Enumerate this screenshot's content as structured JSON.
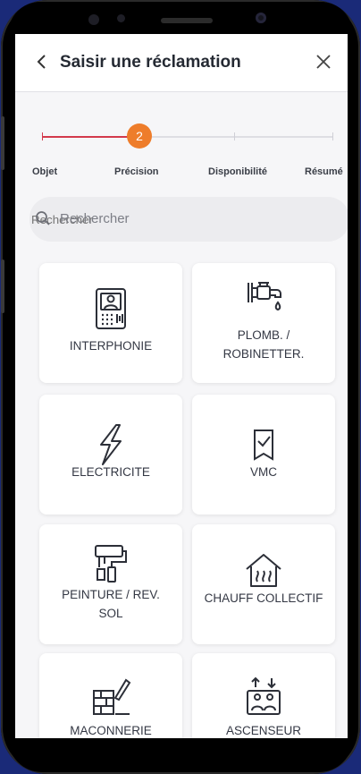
{
  "header": {
    "title": "Saisir une réclamation"
  },
  "stepper": {
    "current": "2",
    "steps": [
      "Objet",
      "Précision",
      "Disponibilité",
      "Résumé"
    ],
    "accent_color": "#ee7d2b",
    "done_color": "#d33a4c"
  },
  "search": {
    "placeholder": "Rechercher"
  },
  "categories": [
    {
      "label_line1": "INTERPHONIE",
      "label_line2": "",
      "icon": "intercom-icon"
    },
    {
      "label_line1": "PLOMB. /",
      "label_line2": "ROBINETTER.",
      "icon": "faucet-icon"
    },
    {
      "label_line1": "ELECTRICITE",
      "label_line2": "",
      "icon": "lightning-icon"
    },
    {
      "label_line1": "VMC",
      "label_line2": "",
      "icon": "ventilation-icon"
    },
    {
      "label_line1": "PEINTURE / REV.",
      "label_line2": "SOL",
      "icon": "paint-roller-icon"
    },
    {
      "label_line1": "CHAUFF COLLECTIF",
      "label_line2": "",
      "icon": "heating-icon"
    },
    {
      "label_line1": "MACONNERIE",
      "label_line2": "",
      "icon": "masonry-icon"
    },
    {
      "label_line1": "ASCENSEUR",
      "label_line2": "",
      "icon": "elevator-icon"
    }
  ]
}
